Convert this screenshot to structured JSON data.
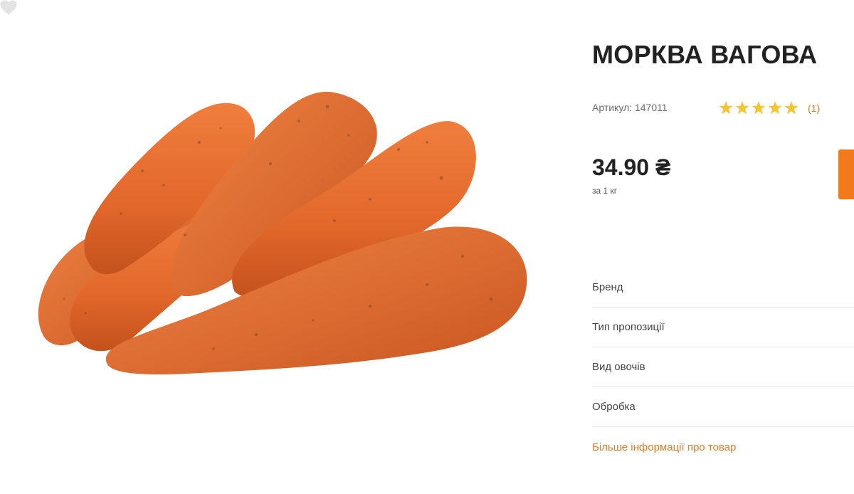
{
  "product": {
    "title": "МОРКВА ВАГОВА",
    "sku_label": "Артикул: 147011",
    "rating_stars": 5,
    "rating_max": 5,
    "reviews_count": "(1)",
    "price": "34.90 ₴",
    "unit": "за 1 кг",
    "image_icon": "carrots-photo"
  },
  "attributes": [
    {
      "label": "Бренд"
    },
    {
      "label": "Тип пропозиції"
    },
    {
      "label": "Вид овочів"
    },
    {
      "label": "Обробка"
    }
  ],
  "more_info_link": "Більше інформації про товар",
  "colors": {
    "accent": "#e87b23",
    "cart_button": "#f27a1a",
    "star": "#f6c532",
    "carrot": "#e06a2c"
  }
}
